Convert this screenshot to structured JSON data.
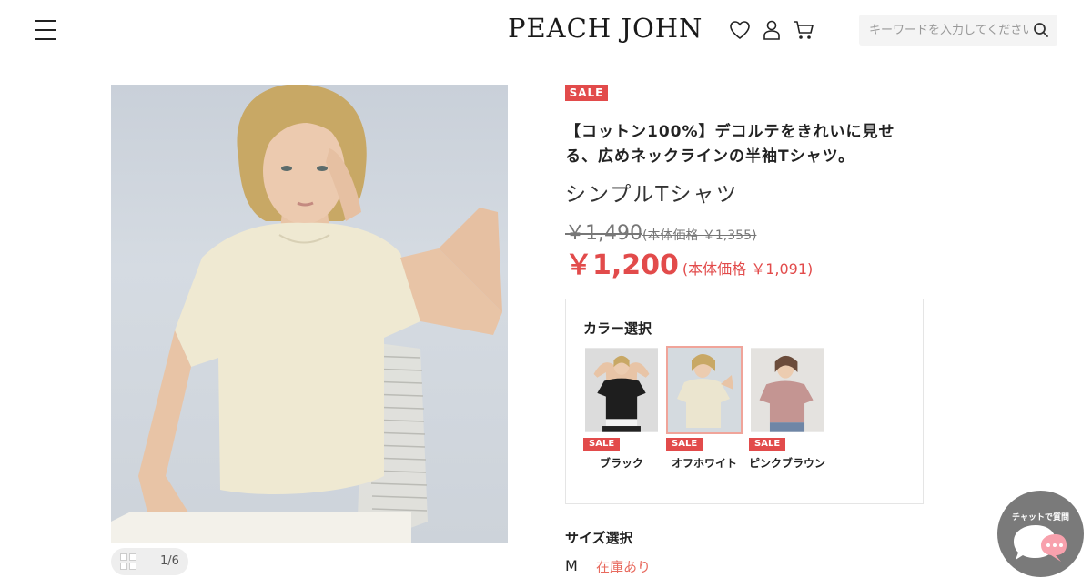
{
  "header": {
    "logo": "PEACH JOHN",
    "search_placeholder": "キーワードを入力してください"
  },
  "gallery": {
    "counter": "1/6"
  },
  "product": {
    "sale_badge": "SALE",
    "catchcopy": "【コットン100%】デコルテをきれいに見せる、広めネックラインの半袖Tシャツ。",
    "name": "シンプルTシャツ",
    "old_price": "￥1,490",
    "old_price_sub": "(本体価格 ￥1,355)",
    "price": "￥1,200",
    "price_sub": "(本体価格 ￥1,091)"
  },
  "color": {
    "title": "カラー選択",
    "options": [
      {
        "name": "ブラック",
        "badge": "SALE",
        "tee_color": "#1e1e1e"
      },
      {
        "name": "オフホワイト",
        "badge": "SALE",
        "tee_color": "#ebe5cf",
        "selected": true
      },
      {
        "name": "ピンクブラウン",
        "badge": "SALE",
        "tee_color": "#c49592"
      }
    ]
  },
  "size": {
    "title": "サイズ選択",
    "value": "M",
    "stock": "在庫あり"
  },
  "chat": {
    "label": "チャットで質問"
  },
  "colors": {
    "accent_red": "#e24b4b",
    "stock_text": "#e86a5e",
    "chat_bg": "#7a7a7a",
    "chat_bubble": "#f8a1ad"
  }
}
